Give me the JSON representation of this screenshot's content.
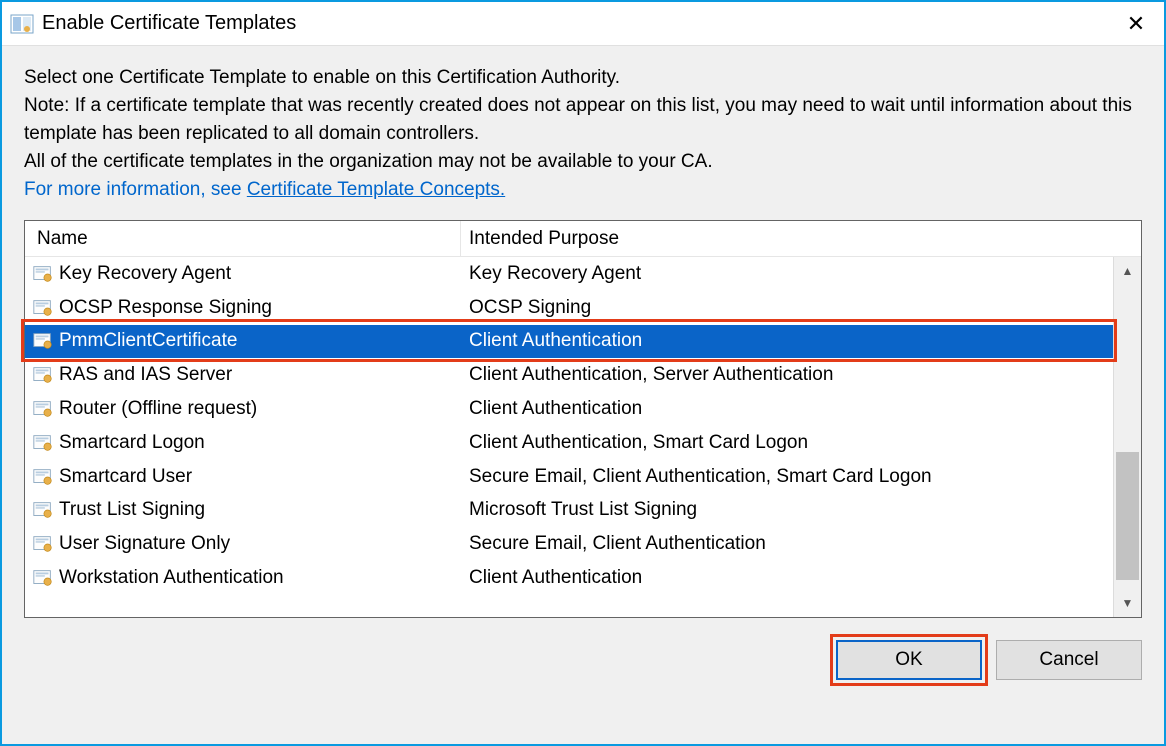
{
  "window": {
    "title": "Enable Certificate Templates"
  },
  "instructions": {
    "line1": "Select one Certificate Template to enable on this Certification Authority.",
    "line2": "Note: If a certificate template that was recently created does not appear on this list, you may need to wait until information about this template has been replicated to all domain controllers.",
    "line3": "All of the certificate templates in the organization may not be available to your CA.",
    "more_prefix": "For more information, see ",
    "more_link": "Certificate Template Concepts."
  },
  "columns": {
    "name": "Name",
    "purpose": "Intended Purpose"
  },
  "rows": [
    {
      "name": "Key Recovery Agent",
      "purpose": "Key Recovery Agent",
      "selected": false
    },
    {
      "name": "OCSP Response Signing",
      "purpose": "OCSP Signing",
      "selected": false
    },
    {
      "name": "PmmClientCertificate",
      "purpose": "Client Authentication",
      "selected": true
    },
    {
      "name": "RAS and IAS Server",
      "purpose": "Client Authentication, Server Authentication",
      "selected": false
    },
    {
      "name": "Router (Offline request)",
      "purpose": "Client Authentication",
      "selected": false
    },
    {
      "name": "Smartcard Logon",
      "purpose": "Client Authentication, Smart Card Logon",
      "selected": false
    },
    {
      "name": "Smartcard User",
      "purpose": "Secure Email, Client Authentication, Smart Card Logon",
      "selected": false
    },
    {
      "name": "Trust List Signing",
      "purpose": "Microsoft Trust List Signing",
      "selected": false
    },
    {
      "name": "User Signature Only",
      "purpose": "Secure Email, Client Authentication",
      "selected": false
    },
    {
      "name": "Workstation Authentication",
      "purpose": "Client Authentication",
      "selected": false
    }
  ],
  "buttons": {
    "ok": "OK",
    "cancel": "Cancel"
  },
  "highlight_row_index": 2,
  "highlight_ok": true
}
